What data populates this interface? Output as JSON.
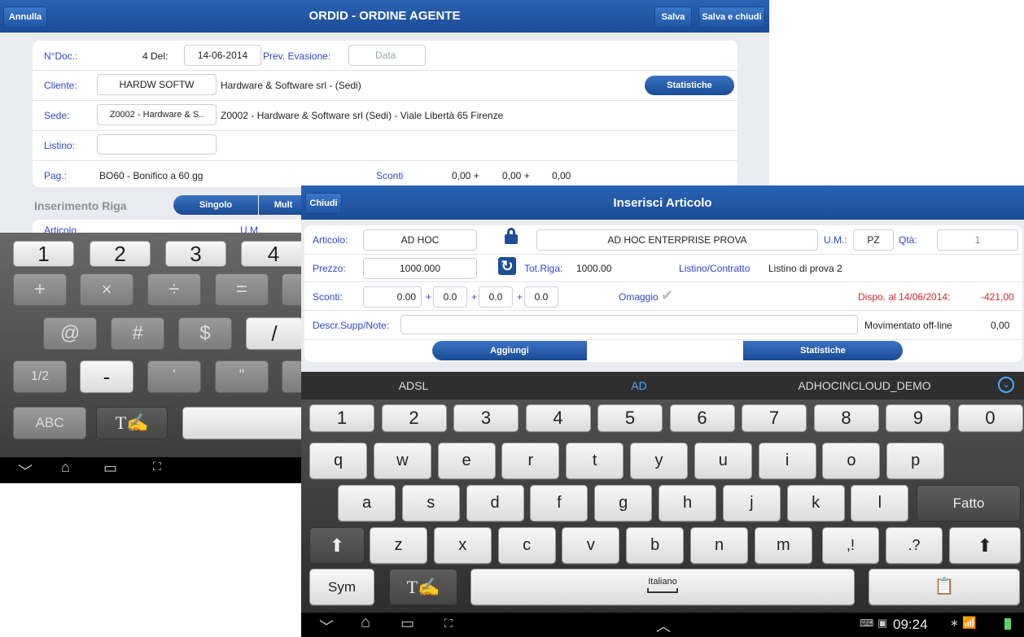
{
  "back": {
    "title": "ORDID - ORDINE AGENTE",
    "annulla": "Annulla",
    "salva": "Salva",
    "salva_chiudi": "Salva e chiudi",
    "ndoc_label": "N°Doc.:",
    "ndoc_value": "4 Del:",
    "date": "14-06-2014",
    "prev_evasione_label": "Prev. Evasione:",
    "data_placeholder": "Data",
    "cliente_label": "Cliente:",
    "cliente_code": "HARDW SOFTW",
    "cliente_desc": "Hardware & Software srl  - (Sedi)",
    "statistiche": "Statistiche",
    "sede_label": "Sede:",
    "sede_code": "Z0002 - Hardware & S..",
    "sede_desc": "Z0002 - Hardware & Software srl  (Sedi) - Viale Libertà 65 Firenze",
    "listino_label": "Listino:",
    "pag_label": "Pag.:",
    "pag_value": "BO60 - Bonifico a 60 gg",
    "sconti_label": "Sconti",
    "sconti_1": "0,00 +",
    "sconti_2": "0,00 +",
    "sconti_3": "0,00",
    "inserimento_riga": "Inserimento Riga",
    "singolo": "Singolo",
    "multi": "Mult",
    "articolo_partial": "Articolo",
    "um_partial": "U.M.",
    "keypad": {
      "row1": [
        "1",
        "2",
        "3",
        "4"
      ],
      "row2": [
        "+",
        "×",
        "÷",
        "="
      ],
      "row3": [
        "@",
        "#",
        "$",
        "/"
      ],
      "row4": [
        "1/2",
        "-",
        "'",
        "\""
      ],
      "abc": "ABC"
    }
  },
  "front": {
    "title": "Inserisci Articolo",
    "chiudi": "Chiudi",
    "articolo_label": "Articolo:",
    "articolo_code": "AD HOC",
    "articolo_desc": "AD HOC ENTERPRISE PROVA",
    "um_label": "U.M.:",
    "um_value": "PZ",
    "qta_label": "Qtà:",
    "qta_value": "1",
    "prezzo_label": "Prezzo:",
    "prezzo_value": "1000.000",
    "totriga_label": "Tot.Riga:",
    "totriga_value": "1000.00",
    "listino_contratto_label": "Listino/Contratto",
    "listino_contratto_value": "Listino di prova 2",
    "sconti_label": "Sconti:",
    "sconti_values": [
      "0.00",
      "0.0",
      "0.0",
      "0.0"
    ],
    "plus": "+",
    "omaggio_label": "Omaggio",
    "dispo_label": "Dispo. al 14/06/2014:",
    "dispo_value": "-421,00",
    "descr_label": "Descr.Supp/Note:",
    "movimentato_label": "Movimentato off-line",
    "movimentato_value": "0,00",
    "aggiungi": "Aggiungi",
    "statistiche": "Statistiche"
  },
  "keyboard": {
    "suggestions": [
      "ADSL",
      "AD",
      "ADHOCINCLOUD_DEMO"
    ],
    "numbers": [
      "1",
      "2",
      "3",
      "4",
      "5",
      "6",
      "7",
      "8",
      "9",
      "0"
    ],
    "row_q": [
      "q",
      "w",
      "e",
      "r",
      "t",
      "y",
      "u",
      "i",
      "o",
      "p"
    ],
    "row_a": [
      "a",
      "s",
      "d",
      "f",
      "g",
      "h",
      "j",
      "k",
      "l"
    ],
    "fatto": "Fatto",
    "row_z": [
      "z",
      "x",
      "c",
      "v",
      "b",
      "n",
      "m"
    ],
    "comma_key": ",!",
    "period_key": ".?",
    "sym": "Sym",
    "space_label": "Italiano",
    "colors": {
      "accent": "#2f47d2",
      "bar": "#1f57a4",
      "red": "#d8262b",
      "suggest_active": "#4aa8ff"
    }
  },
  "statusbar": {
    "time": "09:24"
  }
}
